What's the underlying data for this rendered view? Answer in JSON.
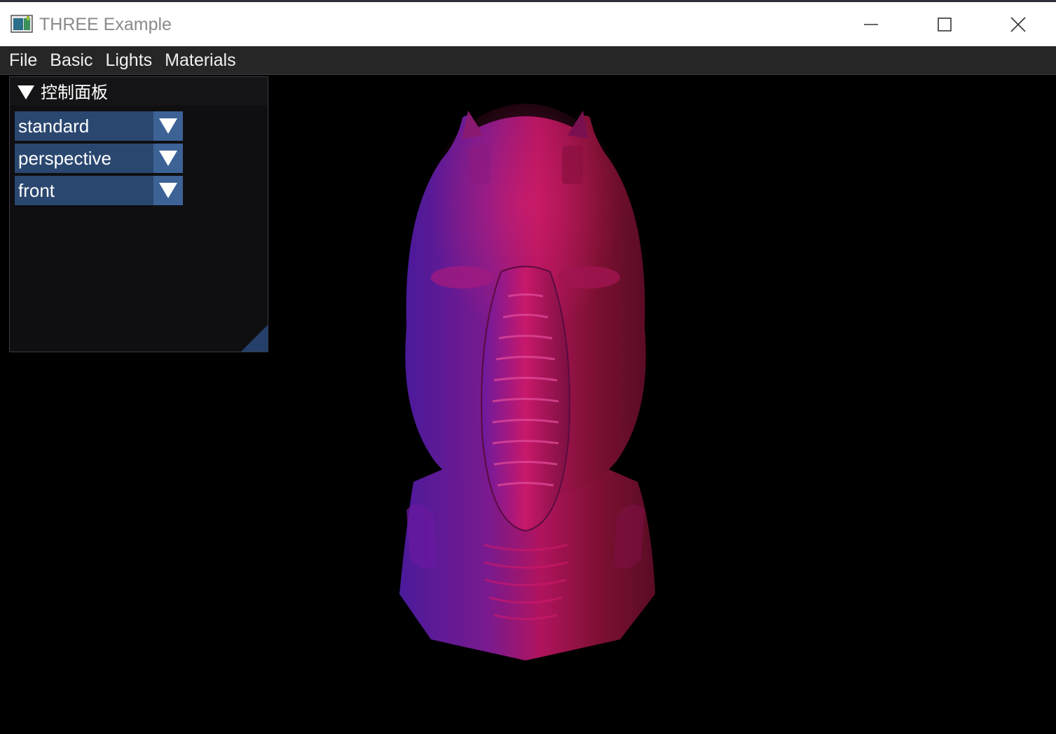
{
  "window": {
    "title": "THREE Example",
    "icons": {
      "app": "app-icon",
      "minimize": "minimize-icon",
      "maximize": "maximize-icon",
      "close": "close-icon"
    }
  },
  "menubar": {
    "items": [
      "File",
      "Basic",
      "Lights",
      "Materials"
    ]
  },
  "panel": {
    "title": "控制面板",
    "collapse_icon": "triangle-down-icon",
    "combos": [
      {
        "value": "standard"
      },
      {
        "value": "perspective"
      },
      {
        "value": "front"
      }
    ]
  },
  "colors": {
    "menubar_bg": "#262626",
    "panel_bg": "#0f0f11",
    "combo_bg": "#2a4770",
    "combo_btn_bg": "#3c6296",
    "model_magenta": "#c0185c",
    "model_purple": "#5a1ca0"
  }
}
